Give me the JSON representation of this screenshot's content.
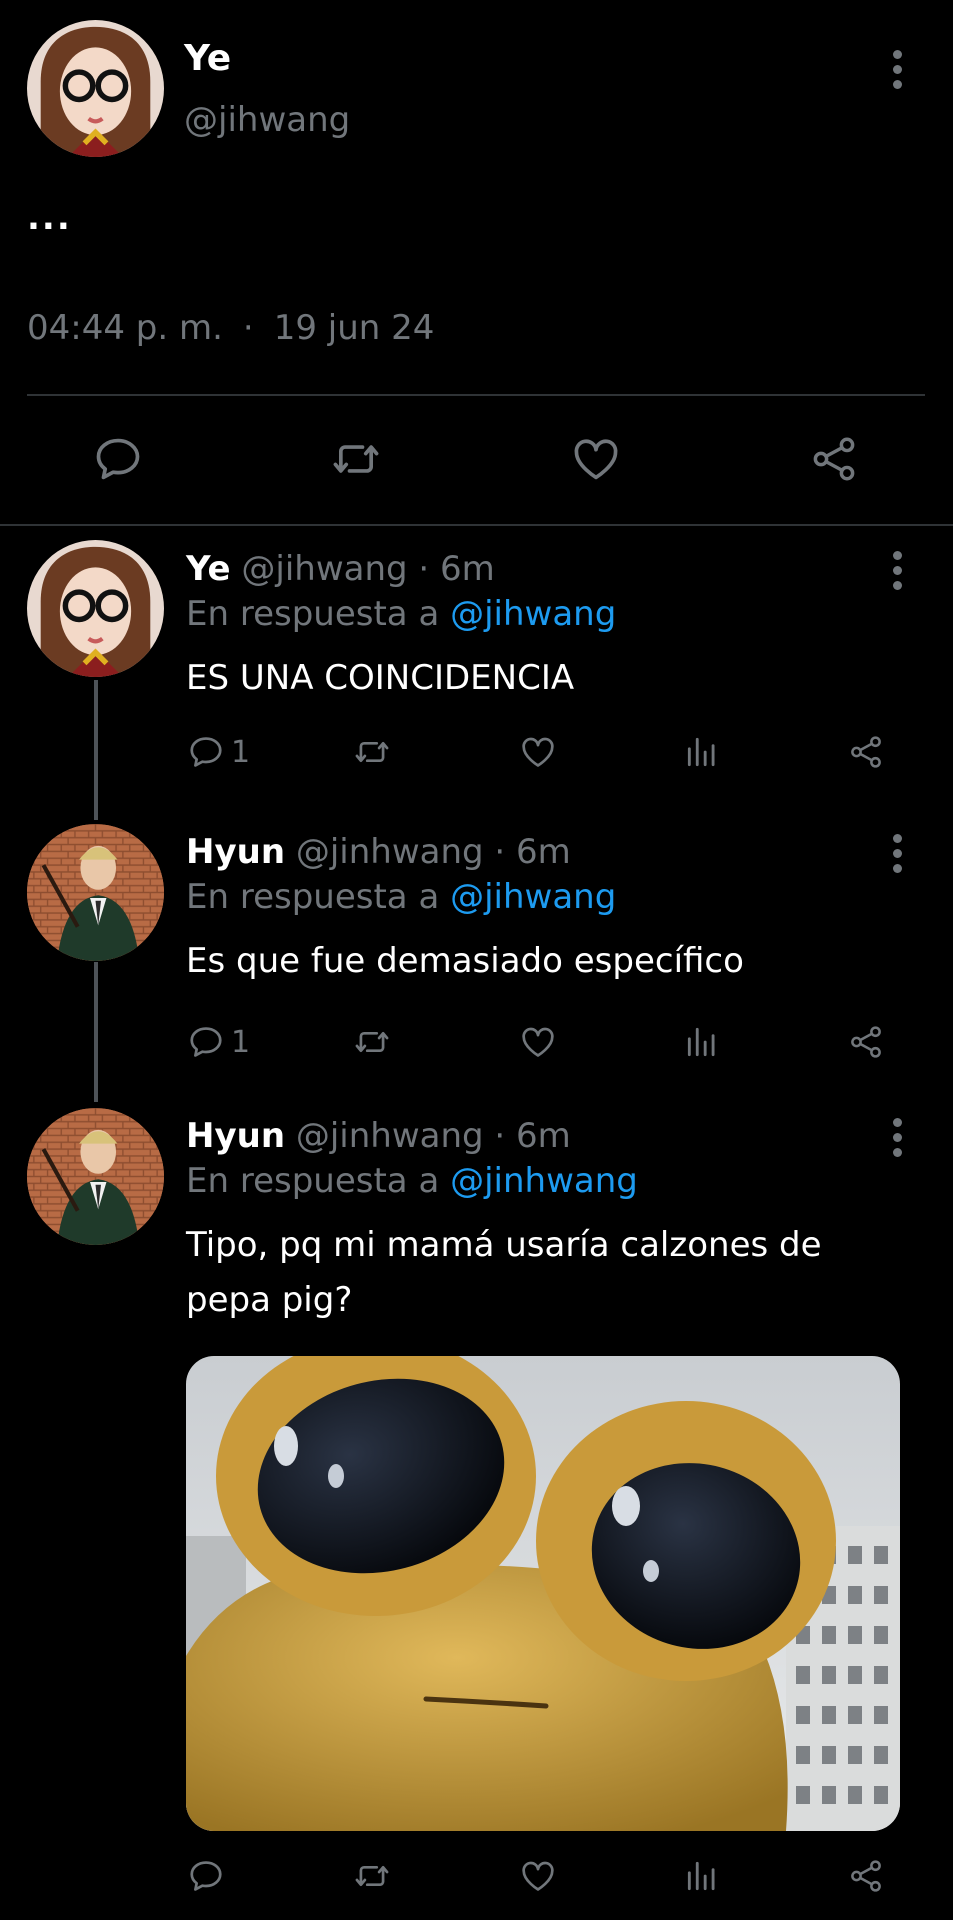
{
  "main_tweet": {
    "display_name": "Ye",
    "handle": "@jihwang",
    "text": "...",
    "time": "04:44 p. m.",
    "separator": "·",
    "date": "19 jun 24"
  },
  "replies": [
    {
      "display_name": "Ye",
      "handle": "@jihwang",
      "age": "· 6m",
      "reply_prefix": "En respuesta a",
      "reply_to": "@jihwang",
      "text": "ES UNA COINCIDENCIA",
      "reply_count": "1"
    },
    {
      "display_name": "Hyun",
      "handle": "@jinhwang",
      "age": "· 6m",
      "reply_prefix": "En respuesta a",
      "reply_to": "@jihwang",
      "text": "Es que fue demasiado específico",
      "reply_count": "1"
    },
    {
      "display_name": "Hyun",
      "handle": "@jinhwang",
      "age": "· 6m",
      "reply_prefix": "En respuesta a",
      "reply_to": "@jinhwang",
      "text_line1": "Tipo, pq mi mamá usaría calzones de",
      "text_line2": "pepa pig?",
      "reply_count": ""
    }
  ],
  "icons": {
    "reply": "speech-bubble-icon",
    "retweet": "retweet-arrows-icon",
    "like": "heart-icon",
    "views": "bar-chart-icon",
    "share": "share-nodes-icon",
    "more": "vertical-dots-icon"
  },
  "colors": {
    "background": "#000000",
    "text": "#e7e9ea",
    "muted": "#71767b",
    "link": "#1d9bf0"
  }
}
